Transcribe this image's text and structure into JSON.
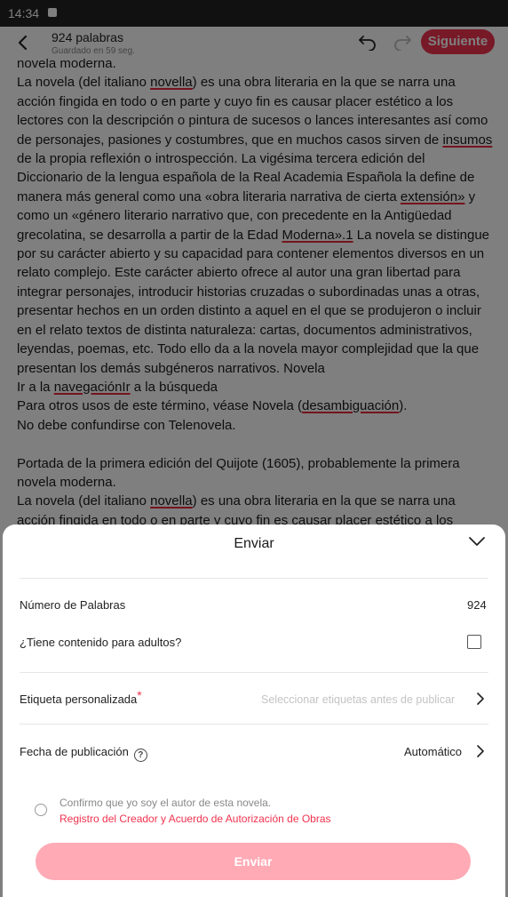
{
  "status_bar": {
    "time": "14:34"
  },
  "header": {
    "word_count": "924 palabras",
    "saved_status": "Guardado en 59 seg.",
    "next_label": "Siguiente"
  },
  "editor": {
    "paragraphs": [
      "novela moderna.",
      "La novela (del italiano novella) es una obra literaria en la que se narra una acción fingida en todo o en parte y cuyo fin es causar placer estético a los lectores con la descripción o pintura de sucesos o lances interesantes así como de personajes, pasiones y costumbres, que en muchos casos sirven de insumos de la propia reflexión o introspección. La vigésima tercera edición del Diccionario de la lengua española de la Real Academia Española la define de manera más general como una «obra literaria narrativa de cierta extensión» y como un «género literario narrativo que, con precedente en la Antigüedad grecolatina, se desarrolla a partir de la Edad Moderna».1 La novela se distingue por su carácter abierto y su capacidad para contener elementos diversos en un relato complejo. Este carácter abierto ofrece al autor una gran libertad para integrar personajes, introducir historias cruzadas o subordinadas unas a otras, presentar hechos en un orden distinto a aquel en el que se produjeron o incluir en el relato textos de distinta naturaleza: cartas, documentos administrativos, leyendas, poemas, etc. Todo ello da a la novela mayor complejidad que la que presentan los demás subgéneros narrativos. Novela",
      "Ir a la navegaciónIr a la búsqueda",
      "Para otros usos de este término, véase Novela (desambiguación).",
      "No debe confundirse con Telenovela.",
      "",
      "Portada de la primera edición del Quijote (1605), probablemente la primera novela moderna.",
      "La novela (del italiano novella) es una obra literaria en la que se narra una acción fingida en todo o en parte y cuyo fin es causar placer estético a los lectores con la descripción o pintura de sucesos o lances interesantes así"
    ]
  },
  "sheet": {
    "title": "Enviar",
    "word_count_label": "Número de Palabras",
    "word_count_value": "924",
    "adult_label": "¿Tiene contenido para adultos?",
    "adult_checked": false,
    "tag_label": "Etiqueta personalizada",
    "tag_required_mark": "*",
    "tag_placeholder": "Seleccionar etiquetas antes de publicar",
    "publish_date_label": "Fecha de publicación",
    "publish_date_help": "?",
    "publish_date_value": "Automático",
    "confirm_text": "Confirmo que yo soy el autor de esta novela.",
    "confirm_link": "Registro del Creador y Acuerdo de Autorización de Obras",
    "submit_label": "Enviar"
  },
  "colors": {
    "accent": "#f0324e",
    "submit_disabled": "#ffaab5",
    "spell_underline": "#e8283c"
  }
}
